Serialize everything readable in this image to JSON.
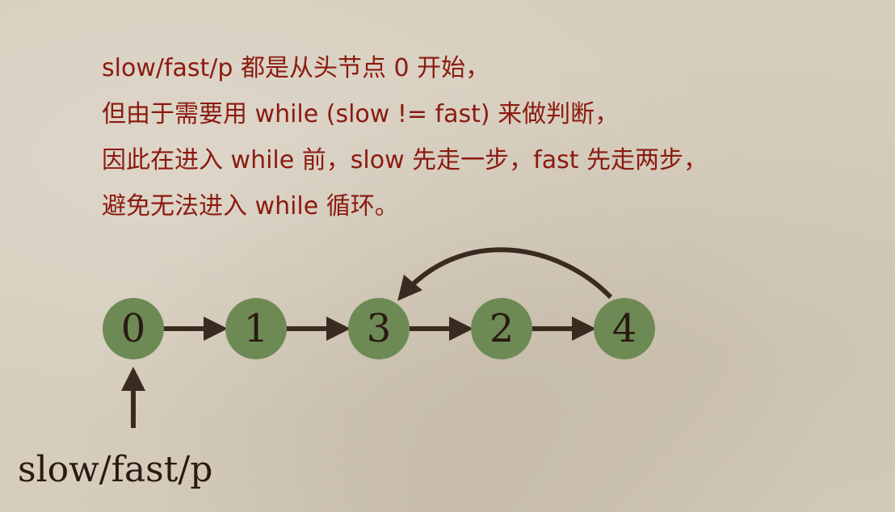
{
  "explanation_lines": [
    "slow/fast/p 都是从头节点 0 开始，",
    "但由于需要用  while (slow != fast) 来做判断，",
    "因此在进入 while 前，slow 先走一步，fast 先走两步，",
    "避免无法进入 while 循环。"
  ],
  "list": {
    "nodes": [
      {
        "label": "0"
      },
      {
        "label": "1"
      },
      {
        "label": "3"
      },
      {
        "label": "2"
      },
      {
        "label": "4"
      }
    ],
    "cycle_from_label": "4",
    "cycle_to_label": "3"
  },
  "pointer": {
    "label": "slow/fast/p",
    "target_label": "0"
  },
  "colors": {
    "background": "#d6cdbd",
    "text": "#8b1a10",
    "node_fill": "#6d8a55",
    "ink": "#3a2a20"
  }
}
